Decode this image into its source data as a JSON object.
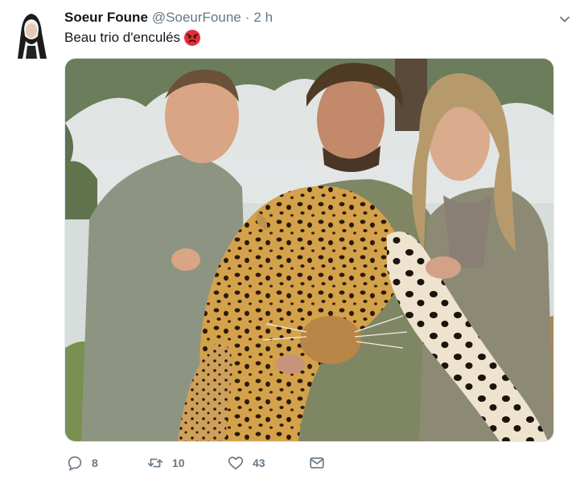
{
  "tweet": {
    "display_name": "Soeur Foune",
    "handle": "@SoeurFoune",
    "separator": "·",
    "time": "2 h",
    "text": "Beau trio d'enculés",
    "emoji": "angry-face-emoji",
    "media_description_icon": "photo"
  },
  "actions": {
    "replies": "8",
    "retweets": "10",
    "likes": "43"
  },
  "icons": {
    "reply": "reply-icon",
    "retweet": "retweet-icon",
    "like": "heart-icon",
    "message": "envelope-icon",
    "caret": "chevron-down-icon"
  },
  "colors": {
    "text": "#14171a",
    "secondary": "#657786",
    "emoji": "#e0303a"
  }
}
